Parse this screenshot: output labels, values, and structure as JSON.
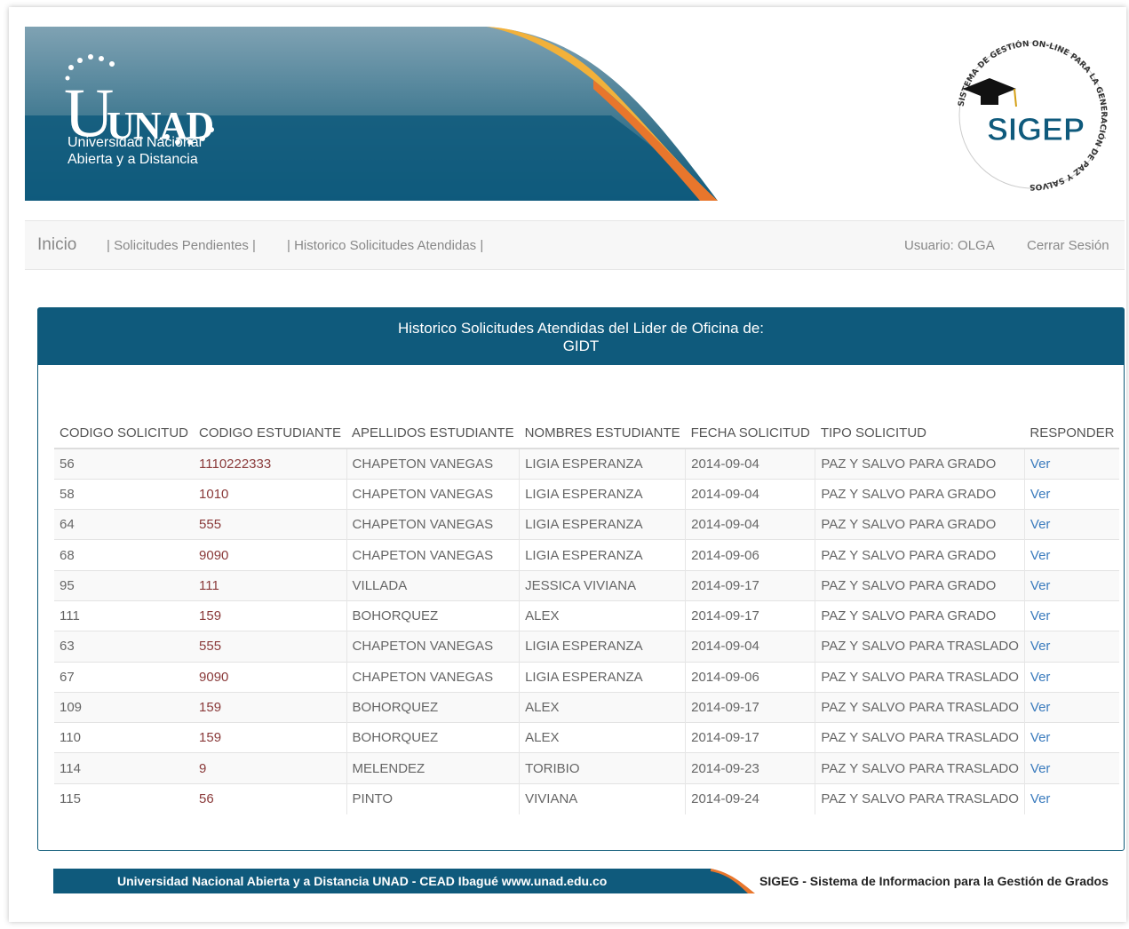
{
  "brand": {
    "logo_text": "UNAD",
    "logo_line1": "Universidad Nacional",
    "logo_line2": "Abierta y a Distancia",
    "seal_title": "SIGEP",
    "seal_ring_text": "SISTEMA DE GESTIÓN ON-LINE PARA LA GENERACIÓN DE PAZ Y SALVOS",
    "colors": {
      "dark_blue": "#0f5a7c",
      "orange": "#e8762c",
      "light_blue": "#6f95a8"
    }
  },
  "nav": {
    "home": "Inicio",
    "pending": "| Solicitudes Pendientes |",
    "history": "| Historico Solicitudes Atendidas |",
    "user": "Usuario: OLGA",
    "logout": "Cerrar Sesión"
  },
  "panel": {
    "title_line1": "Historico Solicitudes Atendidas del Lider de Oficina de:",
    "title_line2": "GIDT"
  },
  "table": {
    "headers": [
      "CODIGO SOLICITUD",
      "CODIGO ESTUDIANTE",
      "APELLIDOS ESTUDIANTE",
      "NOMBRES ESTUDIANTE",
      "FECHA SOLICITUD",
      "TIPO SOLICITUD",
      "RESPONDER"
    ],
    "rows": [
      [
        "56",
        "1110222333",
        "CHAPETON VANEGAS",
        "LIGIA ESPERANZA",
        "2014-09-04",
        "PAZ Y SALVO PARA GRADO",
        "Ver"
      ],
      [
        "58",
        "1010",
        "CHAPETON VANEGAS",
        "LIGIA ESPERANZA",
        "2014-09-04",
        "PAZ Y SALVO PARA GRADO",
        "Ver"
      ],
      [
        "64",
        "555",
        "CHAPETON VANEGAS",
        "LIGIA ESPERANZA",
        "2014-09-04",
        "PAZ Y SALVO PARA GRADO",
        "Ver"
      ],
      [
        "68",
        "9090",
        "CHAPETON VANEGAS",
        "LIGIA ESPERANZA",
        "2014-09-06",
        "PAZ Y SALVO PARA GRADO",
        "Ver"
      ],
      [
        "95",
        "111",
        "VILLADA",
        "JESSICA VIVIANA",
        "2014-09-17",
        "PAZ Y SALVO PARA GRADO",
        "Ver"
      ],
      [
        "111",
        "159",
        "BOHORQUEZ",
        "ALEX",
        "2014-09-17",
        "PAZ Y SALVO PARA GRADO",
        "Ver"
      ],
      [
        "63",
        "555",
        "CHAPETON VANEGAS",
        "LIGIA ESPERANZA",
        "2014-09-04",
        "PAZ Y SALVO PARA TRASLADO",
        "Ver"
      ],
      [
        "67",
        "9090",
        "CHAPETON VANEGAS",
        "LIGIA ESPERANZA",
        "2014-09-06",
        "PAZ Y SALVO PARA TRASLADO",
        "Ver"
      ],
      [
        "109",
        "159",
        "BOHORQUEZ",
        "ALEX",
        "2014-09-17",
        "PAZ Y SALVO PARA TRASLADO",
        "Ver"
      ],
      [
        "110",
        "159",
        "BOHORQUEZ",
        "ALEX",
        "2014-09-17",
        "PAZ Y SALVO PARA TRASLADO",
        "Ver"
      ],
      [
        "114",
        "9",
        "MELENDEZ",
        "TORIBIO",
        "2014-09-23",
        "PAZ Y SALVO PARA TRASLADO",
        "Ver"
      ],
      [
        "115",
        "56",
        "PINTO",
        "VIVIANA",
        "2014-09-24",
        "PAZ Y SALVO PARA TRASLADO",
        "Ver"
      ]
    ]
  },
  "footer": {
    "left": "Universidad Nacional Abierta y a Distancia UNAD - CEAD Ibagué  www.unad.edu.co",
    "right_bold": "SIGEG",
    "right_rest": " - Sistema de Informacion para la Gestión de Grados"
  }
}
